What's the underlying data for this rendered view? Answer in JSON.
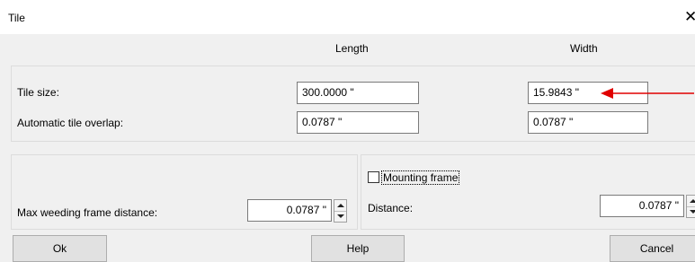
{
  "window": {
    "title": "Tile",
    "close_glyph": "✕"
  },
  "columns": {
    "length": "Length",
    "width": "Width"
  },
  "tile_size": {
    "label": "Tile size:",
    "length": "300.0000 \"",
    "width": "15.9843 \""
  },
  "overlap": {
    "label": "Automatic tile overlap:",
    "length": "0.0787 \"",
    "width": "0.0787 \""
  },
  "weeding": {
    "label": "Max weeding frame distance:",
    "value": "0.0787 \""
  },
  "mounting": {
    "checkbox_label": "Mounting frame",
    "checked": false,
    "distance_label": "Distance:",
    "distance_value": "0.0787 \""
  },
  "buttons": {
    "ok": "Ok",
    "help": "Help",
    "cancel": "Cancel"
  },
  "annotation": {
    "arrow_color": "#e00000"
  }
}
